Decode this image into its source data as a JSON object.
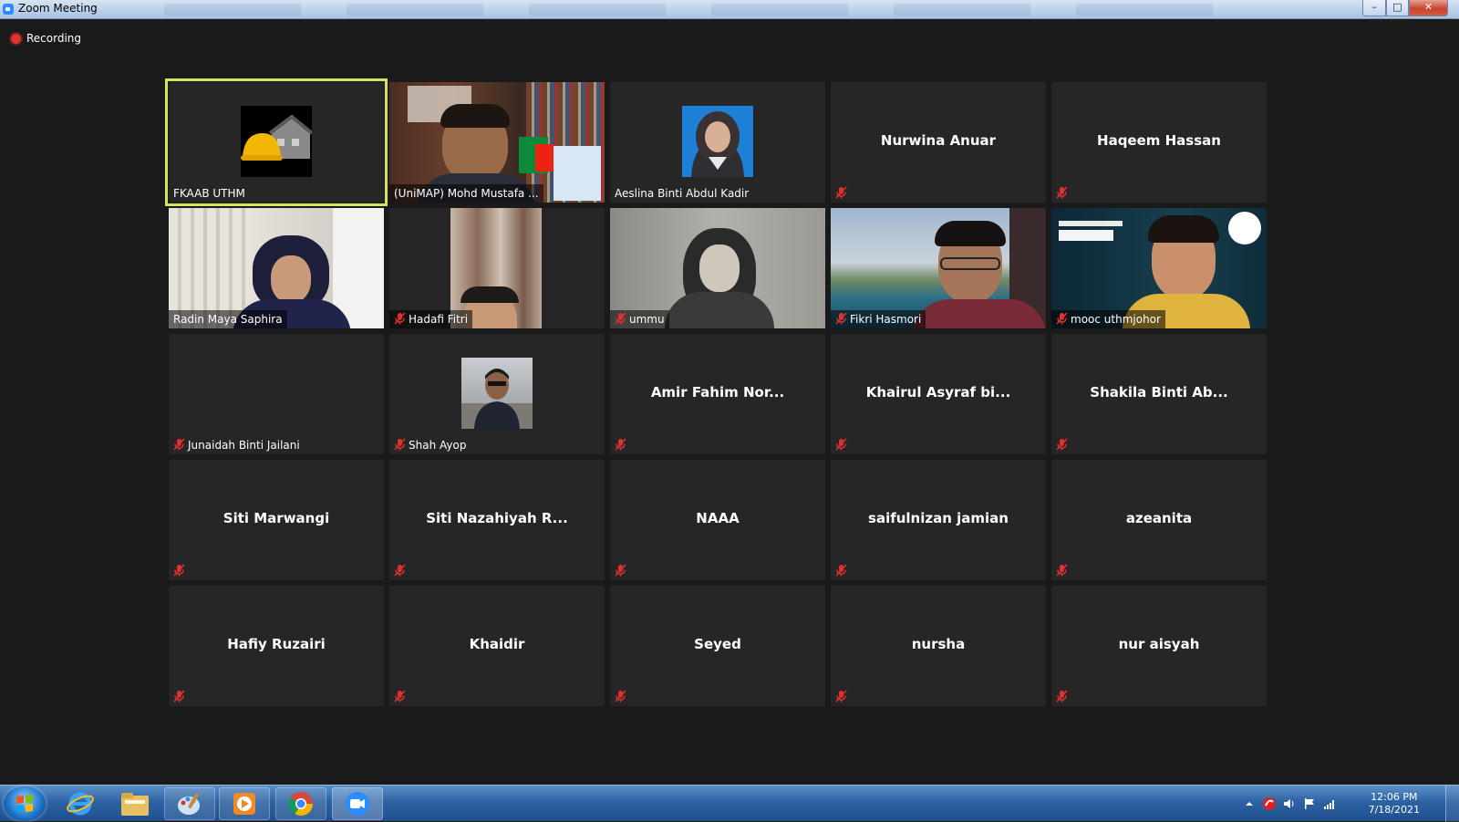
{
  "window": {
    "title": "Zoom Meeting"
  },
  "recording": {
    "label": "Recording"
  },
  "participants": [
    {
      "name": "FKAAB UTHM",
      "type": "logo",
      "muted": false,
      "active": true
    },
    {
      "name": "(UniMAP) Mohd Mustafa ...",
      "type": "video",
      "muted": false
    },
    {
      "name": "Aeslina Binti Abdul Kadir",
      "type": "avatar",
      "muted": false
    },
    {
      "name": "Nurwina Anuar",
      "type": "name",
      "muted": true
    },
    {
      "name": "Haqeem Hassan",
      "type": "name",
      "muted": true
    },
    {
      "name": "Radin Maya Saphira",
      "type": "video",
      "muted": false
    },
    {
      "name": "Hadafi Fitri",
      "type": "video",
      "muted": true
    },
    {
      "name": "ummu",
      "type": "video",
      "muted": true
    },
    {
      "name": "Fikri Hasmori",
      "type": "video",
      "muted": true
    },
    {
      "name": "mooc uthmjohor",
      "type": "video",
      "muted": true
    },
    {
      "name": "Junaidah Binti Jailani",
      "type": "blank",
      "muted": true
    },
    {
      "name": "Shah Ayop",
      "type": "avatar",
      "muted": true
    },
    {
      "name": "Amir Fahim Nor...",
      "type": "name",
      "muted": true
    },
    {
      "name": "Khairul Asyraf bi...",
      "type": "name",
      "muted": true
    },
    {
      "name": "Shakila Binti Ab...",
      "type": "name",
      "muted": true
    },
    {
      "name": "Siti Marwangi",
      "type": "name",
      "muted": true
    },
    {
      "name": "Siti Nazahiyah R...",
      "type": "name",
      "muted": true
    },
    {
      "name": "NAAA",
      "type": "name",
      "muted": true
    },
    {
      "name": "saifulnizan jamian",
      "type": "name",
      "muted": true
    },
    {
      "name": "azeanita",
      "type": "name",
      "muted": true
    },
    {
      "name": "Hafiy Ruzairi",
      "type": "name",
      "muted": true
    },
    {
      "name": "Khaidir",
      "type": "name",
      "muted": true
    },
    {
      "name": "Seyed",
      "type": "name",
      "muted": true
    },
    {
      "name": "nursha",
      "type": "name",
      "muted": true
    },
    {
      "name": "nur aisyah",
      "type": "name",
      "muted": true
    }
  ],
  "taskbar": {
    "apps": [
      "start-button",
      "internet-explorer-icon",
      "file-explorer-icon",
      "paint-icon",
      "media-player-icon",
      "chrome-icon",
      "zoom-icon"
    ],
    "clock": {
      "time": "12:06 PM",
      "date": "7/18/2021"
    }
  },
  "colors": {
    "active_speaker": "#d5e35b",
    "mute_red": "#e0312e",
    "tile_bg": "#262626"
  }
}
